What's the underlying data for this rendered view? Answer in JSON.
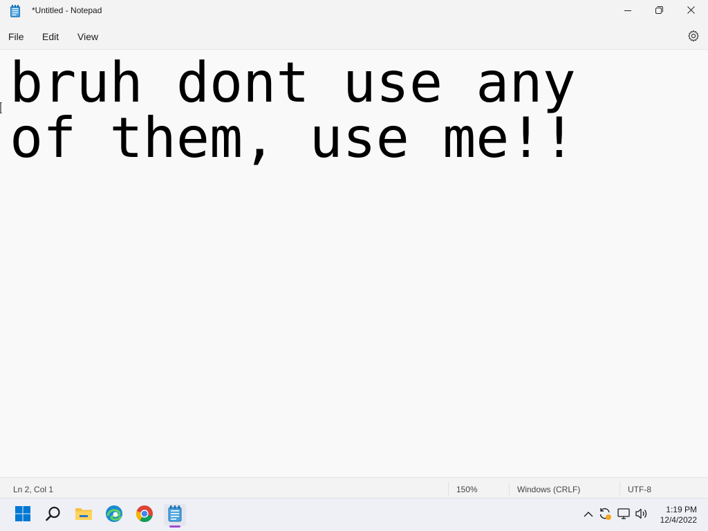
{
  "window": {
    "title": "*Untitled - Notepad",
    "app_icon": "notepad-icon",
    "controls": [
      "minimize-icon",
      "restore-icon",
      "close-icon"
    ]
  },
  "menu": {
    "file": "File",
    "edit": "Edit",
    "view": "View",
    "settings_icon": "gear-icon"
  },
  "editor": {
    "content": "bruh dont use any\nof them, use me!!"
  },
  "statusbar": {
    "position": "Ln 2, Col 1",
    "zoom": "150%",
    "line_ending": "Windows (CRLF)",
    "encoding": "UTF-8"
  },
  "taskbar": {
    "apps": [
      "windows-start-icon",
      "search-icon",
      "file-explorer-icon",
      "edge-icon",
      "chrome-icon",
      "notepad-icon"
    ],
    "active_app": "notepad-icon",
    "tray": [
      "chevron-up-icon",
      "sync-icon",
      "network-icon",
      "volume-icon"
    ],
    "time": "1:19 PM",
    "date": "12/4/2022"
  },
  "colors": {
    "accent": "#a14bd1",
    "windows_blue": "#0078d4",
    "edge_blue": "#1a8ad4",
    "folder_yellow": "#f5c242",
    "chrome_red": "#db4437",
    "chrome_yellow": "#f4b400",
    "chrome_green": "#0f9d58"
  }
}
